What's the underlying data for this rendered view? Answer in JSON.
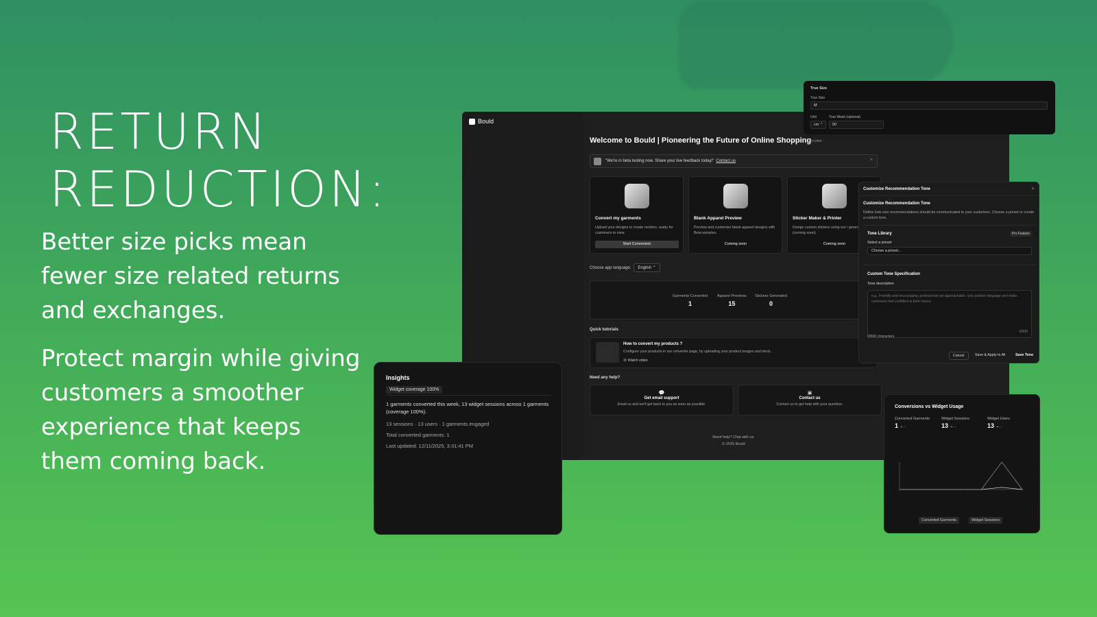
{
  "hero": {
    "title": "RETURN\nREDUCTION:",
    "paragraph1": "Better size picks mean fewer size related returns and exchanges.",
    "paragraph2": "Protect margin while giving customers a smoother experience that keeps them coming back."
  },
  "app": {
    "brand": "Bould",
    "welcome": "Welcome to Bould | Pioneering the Future of Online Shopping",
    "plan": "Pro plan",
    "banner": {
      "text": "\"We're in beta testing now. Share your live feedback today!\"",
      "link": "Contact us",
      "close": "×"
    },
    "cards": [
      {
        "title": "Convert my garments",
        "desc": "Upload your designs to create renders, ready for customers to view.",
        "button": "Start Conversion"
      },
      {
        "title": "Blank Apparel Preview",
        "desc": "Preview and customize blank apparel designs with Beta samples.",
        "button": "Coming soon"
      },
      {
        "title": "Sticker Maker & Printer",
        "desc": "Design custom stickers using our i generator engine (coming soon).",
        "button": "Coming soon"
      }
    ],
    "language": {
      "label": "Choose app language:",
      "value": "English ⌃"
    },
    "stats": [
      {
        "label": "Garments Converted",
        "value": "1"
      },
      {
        "label": "Apparel Previews",
        "value": "15"
      },
      {
        "label": "Stickers Generated",
        "value": "0"
      }
    ],
    "tutorials": {
      "heading": "Quick tutorials",
      "title": "How to convert my products ?",
      "desc": "Configure your products in our converter page, by uploading your product images and stock.",
      "link": "⦿ Watch video"
    },
    "help": {
      "heading": "Need any help?",
      "email": {
        "title": "Get email support",
        "desc": "Email us and we'll get back to you as soon as possible."
      },
      "contact": {
        "title": "Contact us",
        "desc": "Contact us to get help with your question."
      }
    },
    "footer": {
      "line1": "Need help? Chat with us.",
      "line2": "© 2025 Bould"
    }
  },
  "size_panel": {
    "heading": "True Size",
    "size_label": "True Size",
    "size_value": "M",
    "unit_label": "Unit",
    "unit_value": "cm ⌃",
    "waist_label": "True Waist (optional)",
    "waist_value": "50"
  },
  "tone": {
    "header": "Customize Recommendation Tone",
    "title": "Customize Recommendation Tone",
    "desc": "Define how size recommendations should be communicated to your customers. Choose a preset or create a custom tone.",
    "library": "Tone Library",
    "badge": "Pro Feature",
    "select_label": "Select a preset",
    "select_placeholder": "Choose a preset...",
    "custom_heading": "Custom Tone Specification",
    "desc_label": "Tone description",
    "placeholder": "e.g., Friendly and encouraging, professional yet approachable. Use positive language and make customers feel confident in their choice.",
    "counter": "0/500",
    "chars": "0/500 characters",
    "cancel": "Cancel",
    "save_apply": "Save & Apply to All",
    "save": "Save Tone"
  },
  "insights": {
    "title": "Insights",
    "badge": "Widget coverage 100%",
    "summary": "1 garments converted this week, 13 widget sessions across 1 garments (coverage 100%).",
    "sessions": "13 sessions · 13 users · 1 garments engaged",
    "total": "Total converted garments: 1",
    "updated": "Last updated: 12/11/2025, 3:31:41 PM"
  },
  "conversions": {
    "title": "Conversions vs Widget Usage",
    "metrics": [
      {
        "label": "Converted Garments",
        "value": "1"
      },
      {
        "label": "Widget Sessions",
        "value": "13"
      },
      {
        "label": "Widget Users",
        "value": "13"
      }
    ],
    "trend": "➜ –",
    "legend": [
      "Converted Garments",
      "Widget Sessions"
    ]
  },
  "chart_data": {
    "type": "line",
    "series": [
      {
        "name": "Converted Garments",
        "values": [
          0,
          0,
          0,
          0,
          0,
          1,
          0
        ]
      },
      {
        "name": "Widget Sessions",
        "values": [
          0,
          0,
          0,
          0,
          0,
          13,
          0
        ]
      }
    ],
    "ylim": [
      0,
      13
    ]
  }
}
